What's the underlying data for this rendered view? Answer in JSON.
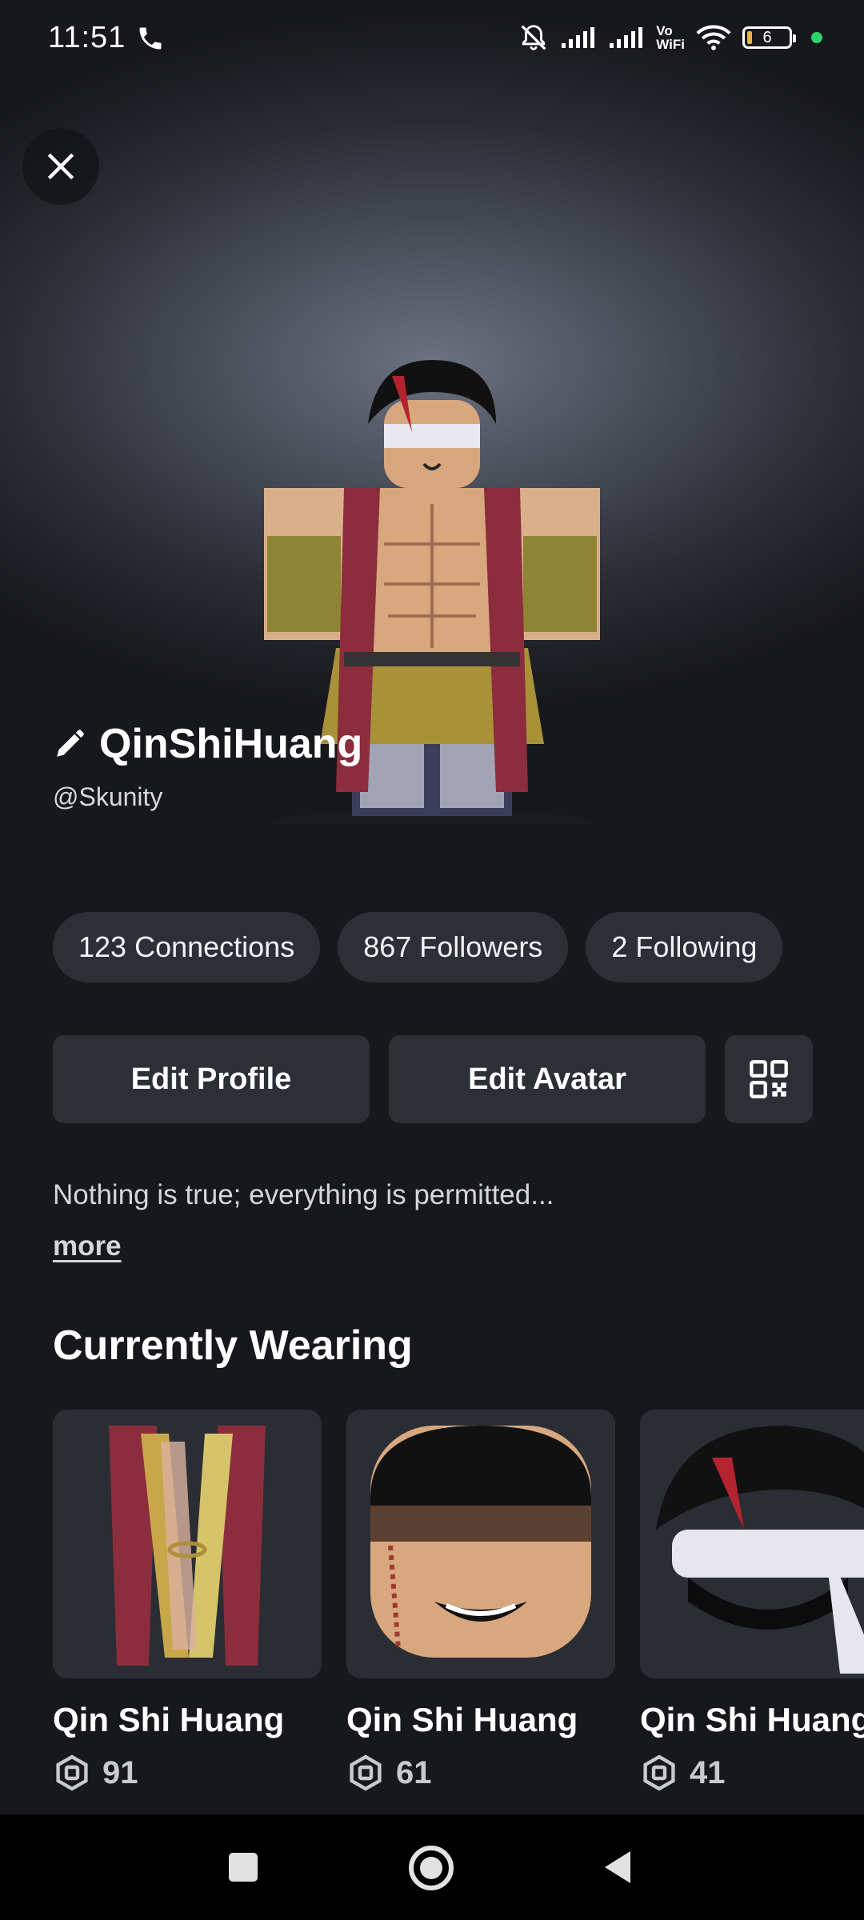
{
  "status_bar": {
    "time": "11:51",
    "vowifi_line1": "Vo",
    "vowifi_line2": "WiFi",
    "battery": "6",
    "icons": [
      "phone-icon",
      "mute-bell-icon",
      "signal-icon",
      "signal-icon",
      "wifi-icon",
      "battery-icon"
    ]
  },
  "profile": {
    "display_name": "QinShiHuang",
    "username": "@Skunity",
    "stats": [
      {
        "label": "123 Connections"
      },
      {
        "label": "867 Followers"
      },
      {
        "label": "2 Following"
      }
    ],
    "edit_profile_label": "Edit Profile",
    "edit_avatar_label": "Edit Avatar",
    "bio": "Nothing is true; everything is permitted...",
    "more_label": "more"
  },
  "currently_wearing": {
    "title": "Currently Wearing",
    "items": [
      {
        "name": "Qin Shi Huang",
        "price": "91",
        "kind": "vest"
      },
      {
        "name": "Qin Shi Huang",
        "price": "61",
        "kind": "face"
      },
      {
        "name": "Qin Shi Huang",
        "price": "41",
        "kind": "hair"
      }
    ]
  },
  "colors": {
    "background": "#17181c",
    "pill": "#2d2f36",
    "status_dot": "#2fd36b"
  }
}
